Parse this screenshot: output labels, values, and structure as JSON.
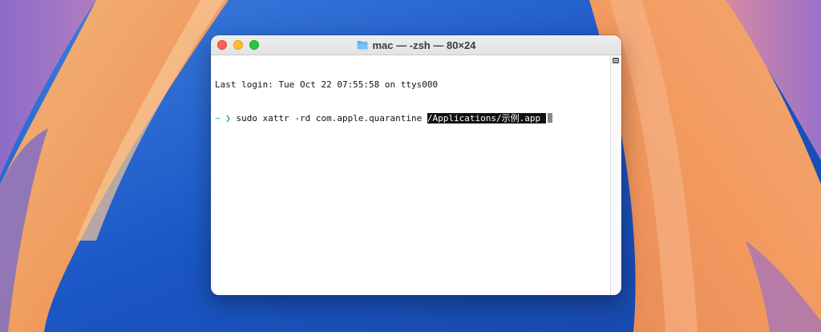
{
  "window": {
    "title": "mac — -zsh — 80×24",
    "folder_icon": "folder-icon"
  },
  "terminal": {
    "last_login": "Last login: Tue Oct 22 07:55:58 on ttys000",
    "prompt_symbol": "~",
    "prompt_arrow": "❯",
    "command": "sudo xattr -rd com.apple.quarantine ",
    "selected_text": "/Applications/示例.app "
  },
  "colors": {
    "close": "#ff5f57",
    "minimize": "#febc2e",
    "zoom": "#28c840",
    "prompt": "#00b3b3",
    "arrow": "#2bb24c"
  }
}
